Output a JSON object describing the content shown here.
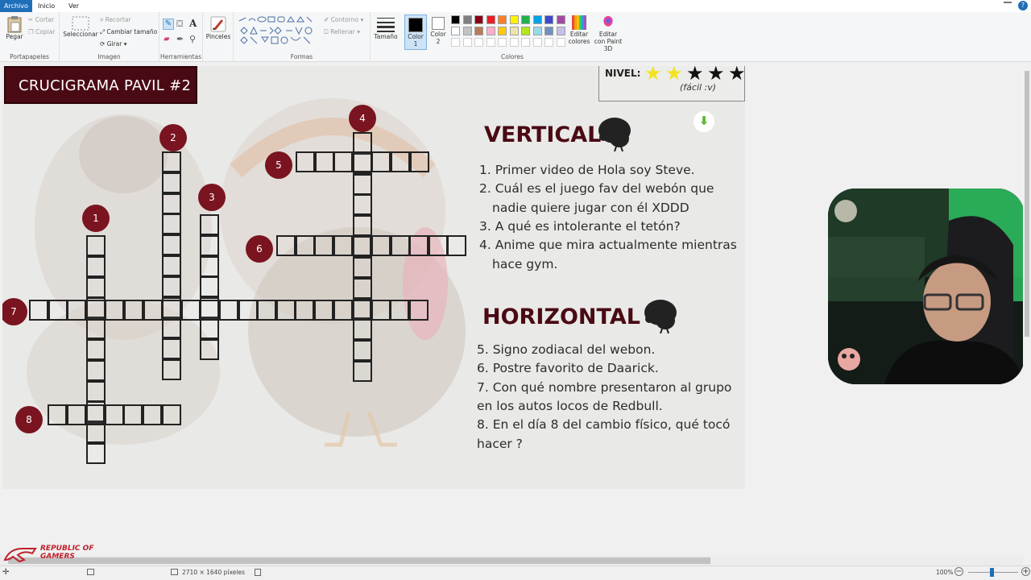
{
  "menu": {
    "file": "Archivo",
    "home": "Inicio",
    "view": "Ver"
  },
  "ribbon": {
    "clipboard": {
      "paste": "Pegar",
      "cut": "Cortar",
      "copy": "Copiar",
      "label": "Portapapeles"
    },
    "image": {
      "select": "Seleccionar",
      "crop": "Recortar",
      "resize": "Cambiar tamaño",
      "rotate": "Girar",
      "label": "Imagen"
    },
    "tools": {
      "label": "Herramientas"
    },
    "brushes": {
      "label": "Pinceles"
    },
    "shapes": {
      "outline": "Contorno",
      "fill": "Rellenar",
      "label": "Formas"
    },
    "size": {
      "label": "Tamaño"
    },
    "colors": {
      "color1": "Color 1",
      "color2": "Color 2",
      "edit": "Editar colores",
      "paint3d": "Editar con Paint 3D",
      "label": "Colores"
    }
  },
  "palette": {
    "row1": [
      "#000000",
      "#7f7f7f",
      "#880015",
      "#ed1c24",
      "#ff7f27",
      "#fff200",
      "#22b14c",
      "#00a2e8",
      "#3f48cc",
      "#a349a4"
    ],
    "row2": [
      "#ffffff",
      "#c3c3c3",
      "#b97a57",
      "#ffaec9",
      "#ffc90e",
      "#efe4b0",
      "#b5e61d",
      "#99d9ea",
      "#7092be",
      "#c8bfe7"
    ],
    "color1": "#000000",
    "color2": "#ffffff"
  },
  "puzzle": {
    "title": "CRUCIGRAMA PAVIL #2",
    "level_label": "NIVEL:",
    "level_note": "(fácil :v)",
    "level_filled": 2,
    "level_total": 5,
    "star_glyph": "★",
    "vertical_heading": "VERTICAL",
    "horizontal_heading": "HORIZONTAL",
    "vertical_clues": [
      "1. Primer video de Hola soy Steve.",
      "2. Cuál es el juego fav del webón que",
      "nadie quiere jugar con él XDDD",
      "3. A qué es intolerante el tetón?",
      "4. Anime que mira actualmente mientras",
      "hace gym."
    ],
    "horizontal_clues": [
      "5. Signo zodiacal del webon.",
      "6. Postre favorito de Daarick.",
      "7. Con qué nombre presentaron al grupo",
      "en los autos locos de Redbull.",
      "8. En el día 8 del cambio físico, qué tocó",
      "hacer ?"
    ],
    "numbers": [
      "1",
      "2",
      "3",
      "4",
      "5",
      "6",
      "7",
      "8"
    ]
  },
  "status": {
    "dimensions": "2710 × 1640 píxeles",
    "zoom": "100%"
  },
  "watermark": {
    "line1": "REPUBLIC OF",
    "line2": "GAMERS"
  },
  "colors": {
    "accent": "#4a0a14",
    "badge": "#7a1420",
    "star_on": "#f2e21f",
    "star_off": "#111111"
  }
}
